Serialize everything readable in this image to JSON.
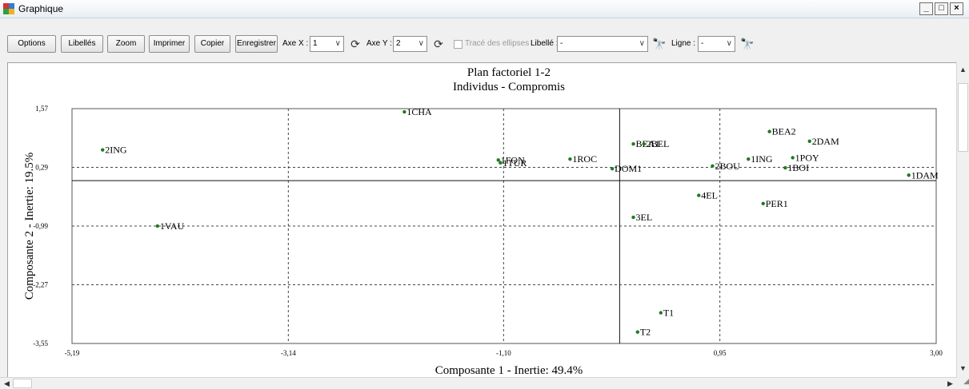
{
  "window": {
    "title": "Graphique",
    "minimize": "_",
    "maximize": "□",
    "close": "×"
  },
  "toolbar": {
    "options": "Options",
    "libelles": "Libellés",
    "zoom": "Zoom",
    "imprimer": "Imprimer",
    "copier": "Copier",
    "enregistrer": "Enregistrer",
    "axe_x_label": "Axe X :",
    "axe_x_value": "1",
    "axe_y_label": "Axe Y :",
    "axe_y_value": "2",
    "ellipses_label": "Tracé des ellipses",
    "libelle_label": "Libellé :",
    "libelle_value": "-",
    "ligne_label": "Ligne :",
    "ligne_value": "-",
    "dropdown_arrow": "∨",
    "swap_glyph": "⟳",
    "find_glyph": "🔭"
  },
  "chart_data": {
    "type": "scatter",
    "title": "Plan factoriel 1-2",
    "subtitle": "Individus - Compromis",
    "xlabel": "Composante 1 - Inertie:  49.4%",
    "ylabel": "Composante 2 - Inertie:  19.5%",
    "xlim": [
      -5.19,
      3.0
    ],
    "ylim": [
      -3.55,
      1.57
    ],
    "xticks": [
      "-5,19",
      "-3,14",
      "-1,10",
      "0,95",
      "3,00"
    ],
    "yticks": [
      "1,57",
      "0,29",
      "-0,99",
      "-2,27",
      "-3,55"
    ],
    "xtick_values": [
      -5.19,
      -3.14,
      -1.1,
      0.95,
      3.0
    ],
    "ytick_values": [
      1.57,
      0.29,
      -0.99,
      -2.27,
      -3.55
    ],
    "grid": "dashed",
    "point_color": "#1e7b1e",
    "points": [
      {
        "label": "2ING",
        "x": -4.9,
        "y": 0.67
      },
      {
        "label": "1VAU",
        "x": -4.38,
        "y": -0.99
      },
      {
        "label": "1CHA",
        "x": -2.04,
        "y": 1.5
      },
      {
        "label": "1FON",
        "x": -1.15,
        "y": 0.45
      },
      {
        "label": "1TUR",
        "x": -1.13,
        "y": 0.39
      },
      {
        "label": "1ROC",
        "x": -0.47,
        "y": 0.47
      },
      {
        "label": "DOM1",
        "x": -0.07,
        "y": 0.26
      },
      {
        "label": "BEA1",
        "x": 0.13,
        "y": 0.8
      },
      {
        "label": "2BEL",
        "x": 0.23,
        "y": 0.8
      },
      {
        "label": "3EL",
        "x": 0.13,
        "y": -0.8
      },
      {
        "label": "4EL",
        "x": 0.75,
        "y": -0.32
      },
      {
        "label": "2BOU",
        "x": 0.88,
        "y": 0.32
      },
      {
        "label": "1ING",
        "x": 1.22,
        "y": 0.47
      },
      {
        "label": "BEA2",
        "x": 1.42,
        "y": 1.07
      },
      {
        "label": "2DAM",
        "x": 1.8,
        "y": 0.86
      },
      {
        "label": "1POY",
        "x": 1.64,
        "y": 0.5
      },
      {
        "label": "1BOI",
        "x": 1.57,
        "y": 0.28
      },
      {
        "label": "PER1",
        "x": 1.36,
        "y": -0.5
      },
      {
        "label": "1DAM",
        "x": 2.74,
        "y": 0.12
      },
      {
        "label": "T1",
        "x": 0.39,
        "y": -2.88
      },
      {
        "label": "T2",
        "x": 0.17,
        "y": -3.3
      }
    ]
  }
}
